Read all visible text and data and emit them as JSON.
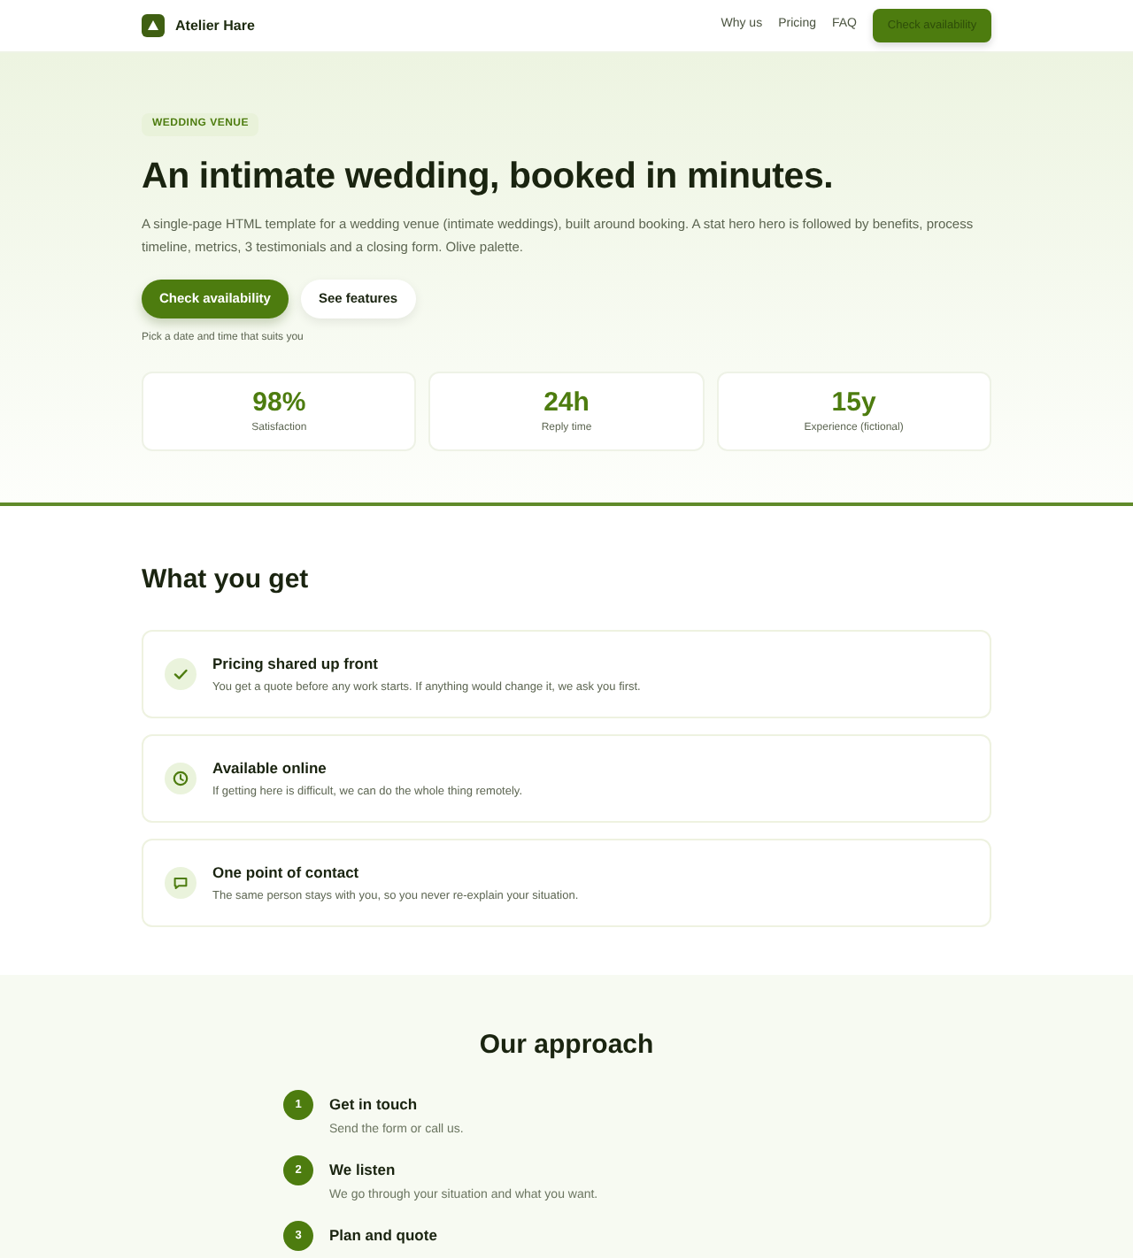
{
  "header": {
    "brand": "Atelier Hare",
    "nav": [
      {
        "label": "Why us"
      },
      {
        "label": "Pricing"
      },
      {
        "label": "FAQ"
      }
    ],
    "cta": "Check availability"
  },
  "hero": {
    "badge": "WEDDING VENUE",
    "title": "An intimate wedding, booked in minutes.",
    "description": "A single-page HTML template for a wedding venue (intimate weddings), built around booking. A stat hero hero is followed by benefits, process timeline, metrics, 3 testimonials and a closing form. Olive palette.",
    "buttons": [
      {
        "label": "Check availability",
        "kind": "primary"
      },
      {
        "label": "See features",
        "kind": "secondary"
      }
    ],
    "note": "Pick a date and time that suits you",
    "stats": [
      {
        "value": "98%",
        "label": "Satisfaction"
      },
      {
        "value": "24h",
        "label": "Reply time"
      },
      {
        "value": "15y",
        "label": "Experience (fictional)"
      }
    ]
  },
  "features": {
    "title": "What you get",
    "items": [
      {
        "title": "Pricing shared up front",
        "description": "You get a quote before any work starts. If anything would change it, we ask you first."
      },
      {
        "title": "Available online",
        "description": "If getting here is difficult, we can do the whole thing remotely."
      },
      {
        "title": "One point of contact",
        "description": "The same person stays with you, so you never re-explain your situation."
      }
    ]
  },
  "approach": {
    "title": "Our approach",
    "steps": [
      {
        "number": "1",
        "title": "Get in touch",
        "description": "Send the form or call us."
      },
      {
        "number": "2",
        "title": "We listen",
        "description": "We go through your situation and what you want."
      },
      {
        "number": "3",
        "title": "Plan and quote"
      }
    ]
  }
}
